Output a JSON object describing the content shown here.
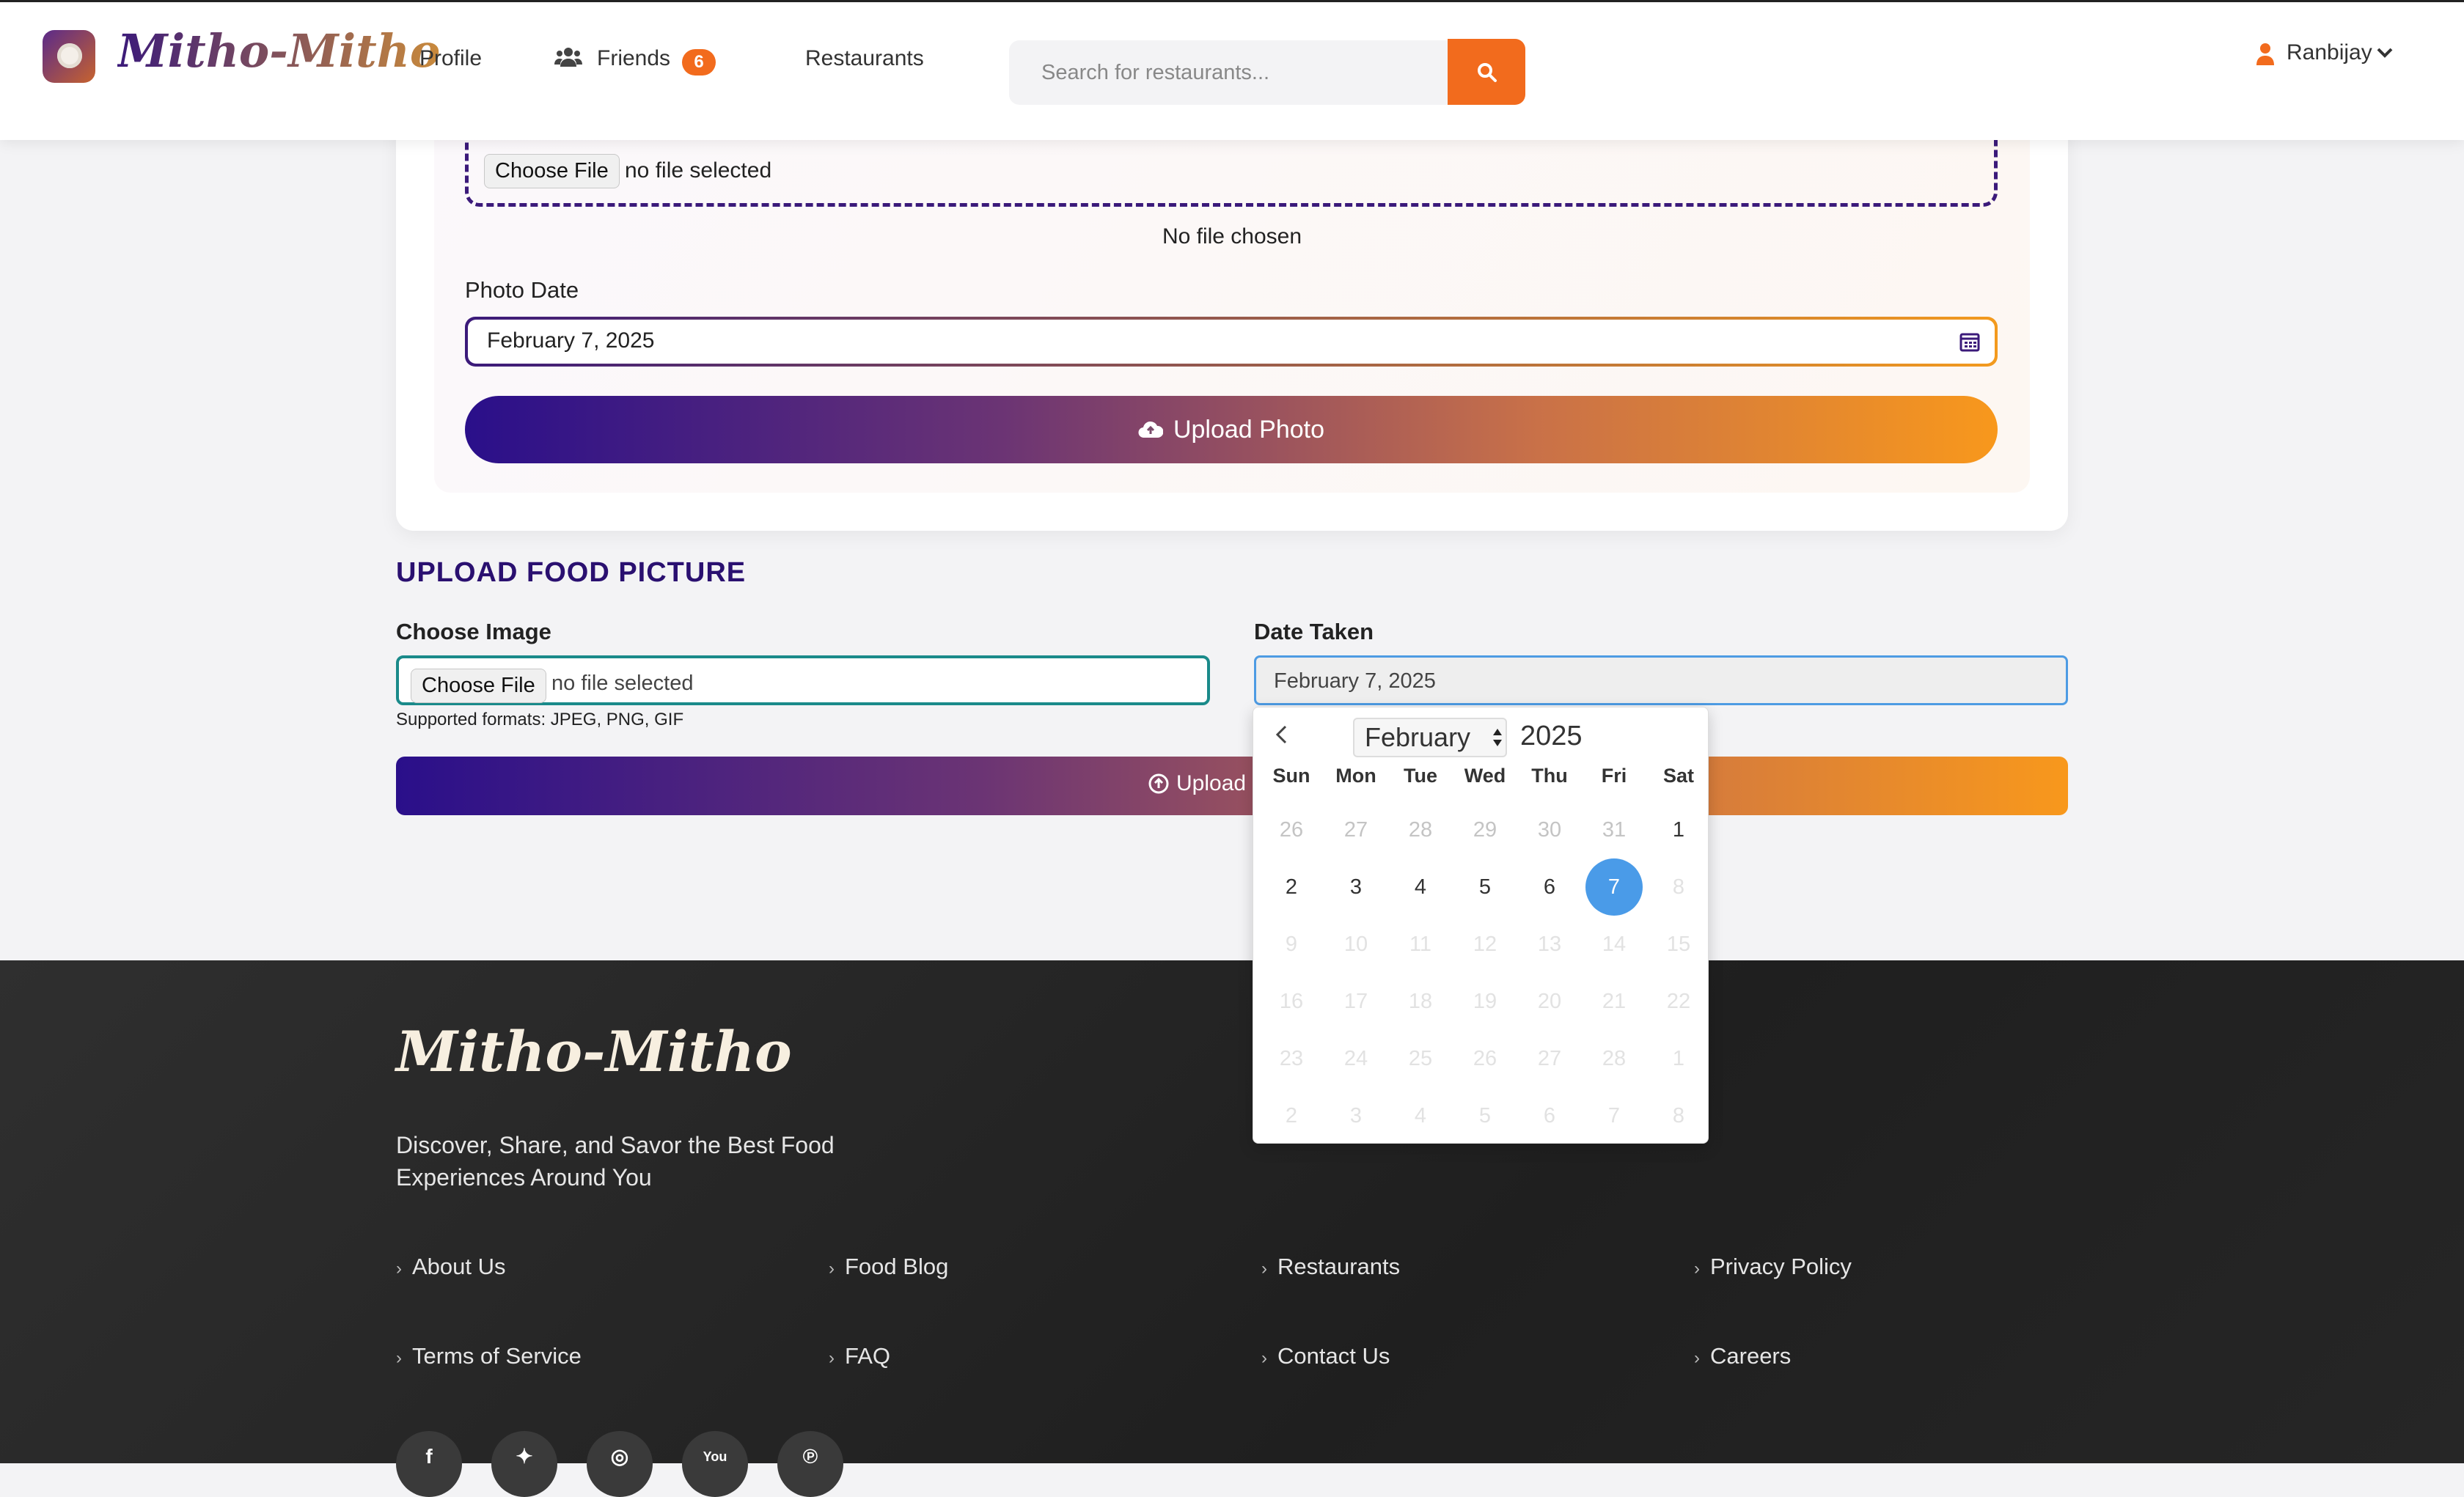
{
  "nav": {
    "brand": "Mitho-Mitho",
    "links": {
      "profile": "Profile",
      "friends": "Friends",
      "friends_count": "6",
      "restaurants": "Restaurants"
    },
    "search_placeholder": "Search for restaurants...",
    "user_name": "Ranbijay",
    "accent": "#f26b1d"
  },
  "photo_card": {
    "file_button": "Choose File",
    "file_status": "no file selected",
    "no_file_chosen": "No file chosen",
    "date_label": "Photo Date",
    "date_value": "February 7, 2025",
    "upload_button": "Upload Photo"
  },
  "food_section": {
    "title": "UPLOAD FOOD PICTURE",
    "choose_image_label": "Choose Image",
    "file_button": "Choose File",
    "file_status": "no file selected",
    "formats": "Supported formats: JPEG, PNG, GIF",
    "date_taken_label": "Date Taken",
    "date_taken_value": "February 7, 2025",
    "upload_button": "Upload"
  },
  "datepicker": {
    "month": "February",
    "year": "2025",
    "weekdays": [
      "Sun",
      "Mon",
      "Tue",
      "Wed",
      "Thu",
      "Fri",
      "Sat"
    ],
    "selected_day": "7",
    "weeks": [
      [
        {
          "d": "26",
          "s": "out"
        },
        {
          "d": "27",
          "s": "out"
        },
        {
          "d": "28",
          "s": "out"
        },
        {
          "d": "29",
          "s": "out"
        },
        {
          "d": "30",
          "s": "out"
        },
        {
          "d": "31",
          "s": "out"
        },
        {
          "d": "1",
          "s": "in"
        }
      ],
      [
        {
          "d": "2",
          "s": "in"
        },
        {
          "d": "3",
          "s": "in"
        },
        {
          "d": "4",
          "s": "in"
        },
        {
          "d": "5",
          "s": "in"
        },
        {
          "d": "6",
          "s": "in"
        },
        {
          "d": "7",
          "s": "sel"
        },
        {
          "d": "8",
          "s": "off"
        }
      ],
      [
        {
          "d": "9",
          "s": "off"
        },
        {
          "d": "10",
          "s": "off"
        },
        {
          "d": "11",
          "s": "off"
        },
        {
          "d": "12",
          "s": "off"
        },
        {
          "d": "13",
          "s": "off"
        },
        {
          "d": "14",
          "s": "off"
        },
        {
          "d": "15",
          "s": "off"
        }
      ],
      [
        {
          "d": "16",
          "s": "off"
        },
        {
          "d": "17",
          "s": "off"
        },
        {
          "d": "18",
          "s": "off"
        },
        {
          "d": "19",
          "s": "off"
        },
        {
          "d": "20",
          "s": "off"
        },
        {
          "d": "21",
          "s": "off"
        },
        {
          "d": "22",
          "s": "off"
        }
      ],
      [
        {
          "d": "23",
          "s": "off"
        },
        {
          "d": "24",
          "s": "off"
        },
        {
          "d": "25",
          "s": "off"
        },
        {
          "d": "26",
          "s": "off"
        },
        {
          "d": "27",
          "s": "off"
        },
        {
          "d": "28",
          "s": "off"
        },
        {
          "d": "1",
          "s": "off"
        }
      ],
      [
        {
          "d": "2",
          "s": "off"
        },
        {
          "d": "3",
          "s": "off"
        },
        {
          "d": "4",
          "s": "off"
        },
        {
          "d": "5",
          "s": "off"
        },
        {
          "d": "6",
          "s": "off"
        },
        {
          "d": "7",
          "s": "off"
        },
        {
          "d": "8",
          "s": "off"
        }
      ]
    ]
  },
  "footer": {
    "brand": "Mitho-Mitho",
    "tagline": "Discover, Share, and Savor the Best Food Experiences Around You",
    "links": [
      "About Us",
      "Food Blog",
      "Restaurants",
      "Privacy Policy",
      "Terms of Service",
      "FAQ",
      "Contact Us",
      "Careers"
    ],
    "social": [
      "facebook-icon",
      "twitter-icon",
      "instagram-icon",
      "youtube-icon",
      "pinterest-icon"
    ]
  }
}
